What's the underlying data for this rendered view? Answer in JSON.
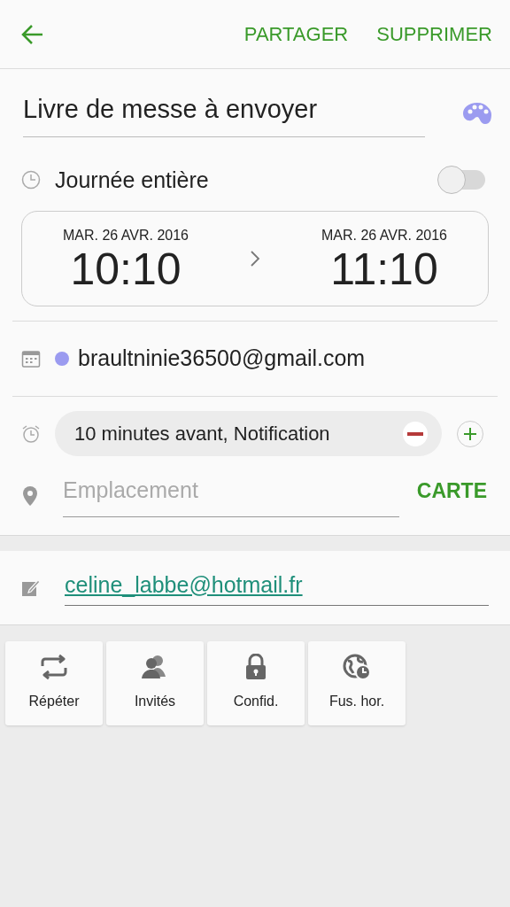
{
  "toolbar": {
    "actions": [
      "PARTAGER",
      "SUPPRIMER"
    ]
  },
  "title": {
    "value": "Livre de messe à envoyer"
  },
  "all_day": {
    "label": "Journée entière",
    "on": false
  },
  "start": {
    "date": "MAR. 26 AVR. 2016",
    "time": "10:10"
  },
  "end": {
    "date": "MAR. 26 AVR. 2016",
    "time": "11:10"
  },
  "calendar": {
    "account": "braultninie36500@gmail.com",
    "color": "#9b9bf0"
  },
  "reminder": {
    "text": "10 minutes avant, Notification"
  },
  "location": {
    "placeholder": "Emplacement",
    "map_button": "CARTE"
  },
  "note": {
    "value": "celine_labbe@hotmail.fr"
  },
  "options": [
    {
      "kind": "repeat",
      "label": "Répéter"
    },
    {
      "kind": "invitees",
      "label": "Invités"
    },
    {
      "kind": "privacy",
      "label": "Confid."
    },
    {
      "kind": "timezone",
      "label": "Fus. hor."
    }
  ]
}
